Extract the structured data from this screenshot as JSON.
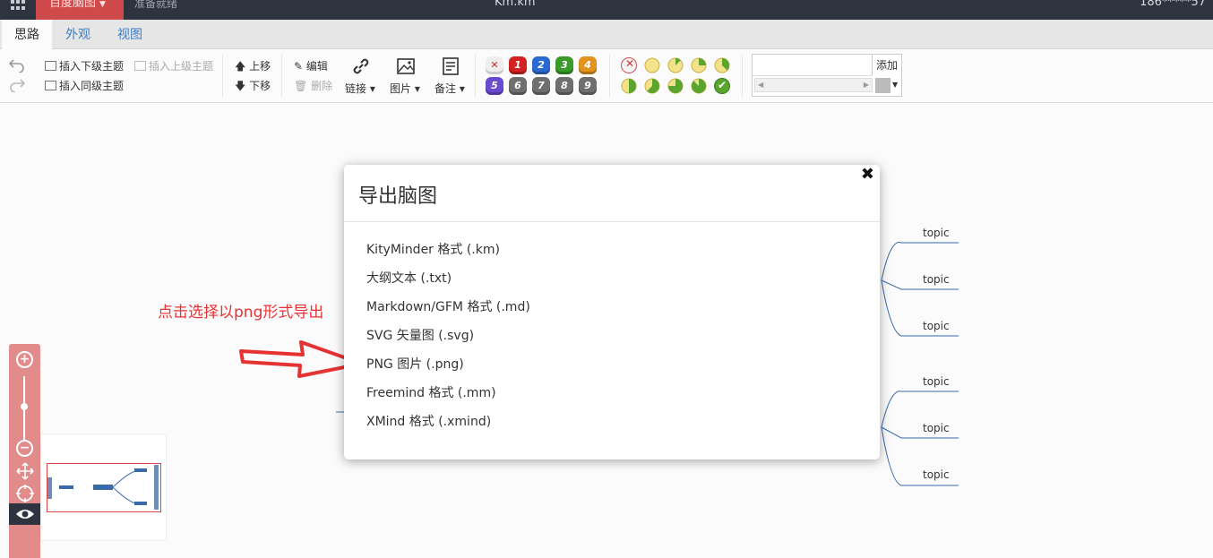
{
  "titlebar": {
    "brand": "百度脑图",
    "status": "准备就绪",
    "filename": "Km.km",
    "user": "186*****57"
  },
  "tabs": [
    {
      "label": "思路",
      "active": true
    },
    {
      "label": "外观",
      "active": false
    },
    {
      "label": "视图",
      "active": false
    }
  ],
  "toolbar": {
    "insert_child": "插入下级主题",
    "insert_parent": "插入上级主题",
    "insert_sibling": "插入同级主题",
    "move_up": "上移",
    "move_down": "下移",
    "edit": "编辑",
    "delete": "删除",
    "link": "链接",
    "image": "图片",
    "note": "备注",
    "priorities": [
      "1",
      "2",
      "3",
      "4",
      "5",
      "6",
      "7",
      "8",
      "9"
    ],
    "priority_colors": [
      "#d42222",
      "#2b6ad1",
      "#3a9a2a",
      "#e39320",
      "#6a4ad1",
      "#6f6f6f",
      "#6f6f6f",
      "#6f6f6f",
      "#6f6f6f"
    ],
    "progress_levels": [
      0,
      1,
      2,
      3,
      4,
      5,
      6,
      7,
      8,
      9
    ],
    "resource_add": "添加"
  },
  "mindmap": {
    "topics": [
      "topic",
      "topic",
      "topic",
      "topic",
      "topic",
      "topic"
    ],
    "line_color": "#3a6aa8"
  },
  "annotation": "点击选择以png形式导出",
  "dialog": {
    "title": "导出脑图",
    "close": "✖",
    "options": [
      "KityMinder 格式 (.km)",
      "大纲文本 (.txt)",
      "Markdown/GFM 格式 (.md)",
      "SVG 矢量图 (.svg)",
      "PNG 图片 (.png)",
      "Freemind 格式 (.mm)",
      "XMind 格式 (.xmind)"
    ]
  }
}
